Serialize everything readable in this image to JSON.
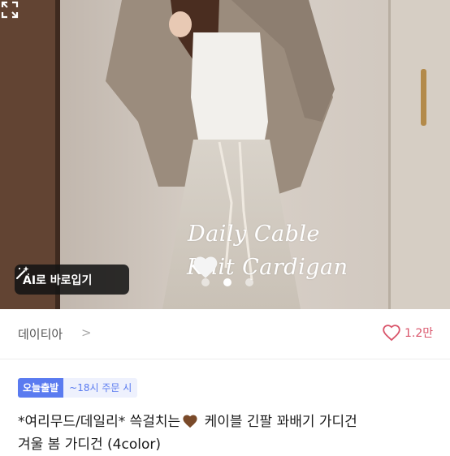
{
  "hero": {
    "overlay_line1": "Daily Cable",
    "overlay_line2": "Knit Cardigan",
    "heart_icon": "white-heart",
    "ai_button_label": "AI로 바로입기",
    "ai_icon": "magic-wand",
    "expand_icon": "expand-corners",
    "carousel": {
      "count": 3,
      "active_index": 1
    }
  },
  "shop": {
    "name": "데이티아",
    "chevron": ">",
    "like_icon": "heart-outline",
    "like_count": "1.2만",
    "accent": "#d9546a"
  },
  "product": {
    "badge_today": "오늘출발",
    "badge_time": "~18시 주문 시",
    "badge_color": "#5a7bf0",
    "title_part1": "*여리무드/데일리* 쓱걸치는",
    "title_emoji": "brown-heart",
    "title_part2": " 케이블 긴팔 꽈배기 가디건",
    "title_line2": "겨울 봄 가디건 (4color)"
  }
}
